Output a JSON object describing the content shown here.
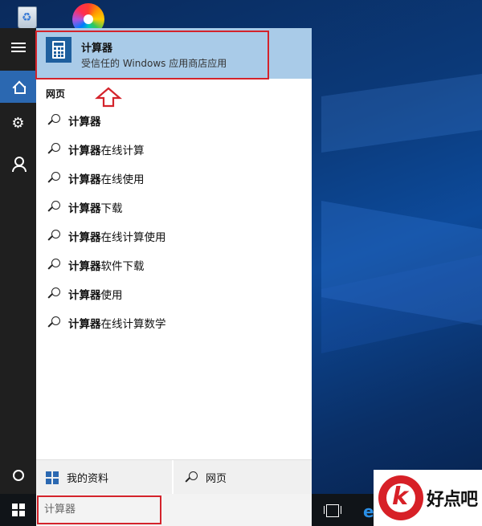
{
  "best_match": {
    "title": "计算器",
    "subtitle": "受信任的 Windows 应用商店应用"
  },
  "section_label": "网页",
  "suggestions": [
    {
      "bold": "计算器",
      "rest": ""
    },
    {
      "bold": "计算器",
      "rest": "在线计算"
    },
    {
      "bold": "计算器",
      "rest": "在线使用"
    },
    {
      "bold": "计算器",
      "rest": "下载"
    },
    {
      "bold": "计算器",
      "rest": "在线计算使用"
    },
    {
      "bold": "计算器",
      "rest": "软件下载"
    },
    {
      "bold": "计算器",
      "rest": "使用"
    },
    {
      "bold": "计算器",
      "rest": "在线计算数学"
    }
  ],
  "filters": {
    "my_stuff_label": "我的资料",
    "web_label": "网页"
  },
  "taskbar": {
    "search_value": "计算器"
  },
  "watermark": {
    "text": "好点吧"
  },
  "colors": {
    "accent": "#2b68b1",
    "highlight": "#a9cbe8",
    "annotation_red": "#d4232b"
  },
  "icons": [
    "recycle-bin-icon",
    "color-wheel-icon",
    "hamburger-icon",
    "home-icon",
    "settings-icon",
    "feedback-icon",
    "cortana-circle-icon",
    "calculator-icon",
    "search-icon",
    "windows-icon",
    "task-view-icon",
    "edge-icon",
    "up-arrow-icon"
  ]
}
